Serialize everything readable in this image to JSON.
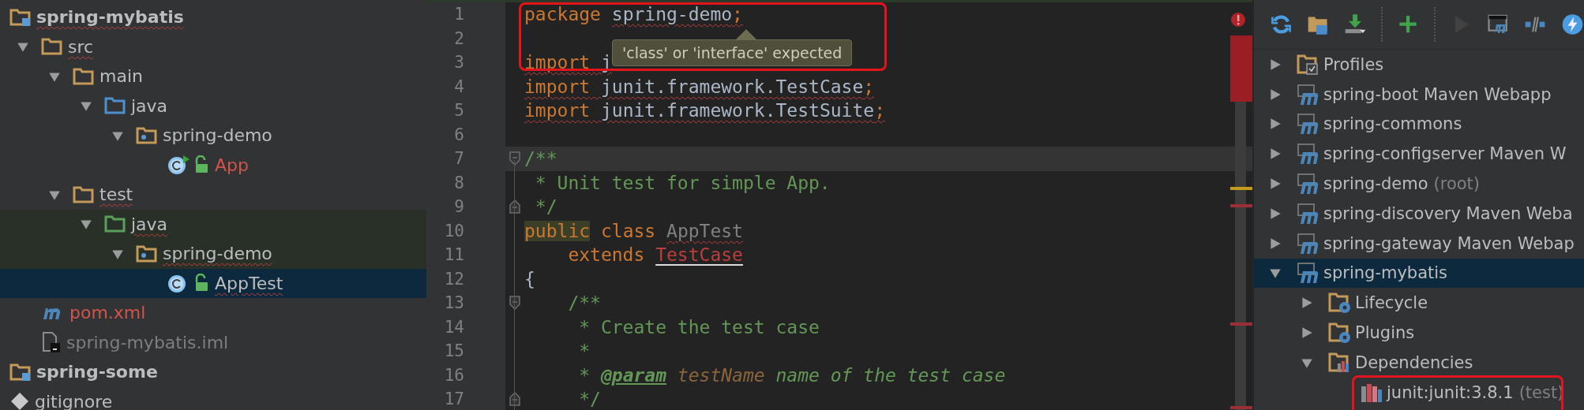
{
  "project_tree": [
    {
      "label": "spring-mybatis",
      "kind": "module",
      "selected": false,
      "tinted": false,
      "error": true,
      "unversioned": false,
      "ignored": false,
      "children": [
        {
          "label": "src",
          "kind": "folder",
          "expanded": true,
          "selected": false,
          "tinted": false,
          "error": true,
          "unversioned": false,
          "ignored": false,
          "children": [
            {
              "label": "main",
              "kind": "folder",
              "expanded": true,
              "selected": false,
              "tinted": false,
              "error": false,
              "unversioned": false,
              "ignored": false,
              "children": [
                {
                  "label": "java",
                  "kind": "source-folder",
                  "expanded": true,
                  "selected": false,
                  "tinted": false,
                  "error": false,
                  "unversioned": false,
                  "ignored": false,
                  "children": [
                    {
                      "label": "spring-demo",
                      "kind": "package",
                      "expanded": true,
                      "selected": false,
                      "tinted": false,
                      "error": false,
                      "unversioned": false,
                      "ignored": false,
                      "children": [
                        {
                          "label": "App",
                          "kind": "class-runnable",
                          "selected": false,
                          "tinted": false,
                          "error": false,
                          "unversioned": true,
                          "ignored": false
                        }
                      ]
                    }
                  ]
                }
              ]
            },
            {
              "label": "test",
              "kind": "folder",
              "expanded": true,
              "selected": false,
              "tinted": false,
              "error": true,
              "unversioned": false,
              "ignored": false,
              "children": [
                {
                  "label": "java",
                  "kind": "test-folder",
                  "expanded": true,
                  "selected": false,
                  "tinted": true,
                  "error": true,
                  "unversioned": false,
                  "ignored": false,
                  "children": [
                    {
                      "label": "spring-demo",
                      "kind": "package",
                      "expanded": true,
                      "selected": false,
                      "tinted": true,
                      "error": true,
                      "unversioned": false,
                      "ignored": false,
                      "children": [
                        {
                          "label": "AppTest",
                          "kind": "class",
                          "selected": true,
                          "tinted": false,
                          "error": true,
                          "unversioned": false,
                          "ignored": false
                        }
                      ]
                    }
                  ]
                }
              ]
            }
          ]
        },
        {
          "label": "pom.xml",
          "kind": "maven-file",
          "selected": false,
          "tinted": false,
          "error": false,
          "unversioned": true,
          "ignored": false
        },
        {
          "label": "spring-mybatis.iml",
          "kind": "iml-file",
          "selected": false,
          "tinted": false,
          "error": false,
          "unversioned": false,
          "ignored": true
        }
      ]
    },
    {
      "label": "spring-some",
      "kind": "module",
      "selected": false,
      "tinted": false,
      "error": false,
      "unversioned": false,
      "ignored": false
    },
    {
      "label": "gitignore",
      "kind": "git-file",
      "selected": false,
      "tinted": false,
      "unversioned": false,
      "ignored": false
    }
  ],
  "editor": {
    "tooltip": "'class' or 'interface' expected",
    "lines": [
      {
        "number": "1",
        "current": false,
        "kind": "plain",
        "tokens": [
          {
            "text": "package ",
            "kind": "keyword",
            "error": false
          },
          {
            "text": "spring-demo",
            "kind": "ident",
            "error": true
          },
          {
            "text": ";",
            "kind": "punct",
            "error": true
          }
        ]
      },
      {
        "number": "2",
        "current": false,
        "kind": "plain"
      },
      {
        "number": "3",
        "current": false,
        "kind": "plain",
        "tokens": [
          {
            "text": "import",
            "kind": "keyword",
            "error": true
          },
          {
            "text": " j",
            "kind": "ident",
            "error": true
          }
        ]
      },
      {
        "number": "4",
        "current": false,
        "kind": "plain",
        "tokens": [
          {
            "text": "import",
            "kind": "keyword",
            "error": true
          },
          {
            "text": " junit.framework.TestCase",
            "kind": "ident",
            "error": true
          },
          {
            "text": ";",
            "kind": "punct",
            "error": true
          }
        ]
      },
      {
        "number": "5",
        "current": false,
        "kind": "plain",
        "tokens": [
          {
            "text": "import",
            "kind": "keyword",
            "error": true
          },
          {
            "text": " junit.framework.TestSuite",
            "kind": "ident",
            "error": true
          },
          {
            "text": ";",
            "kind": "punct",
            "error": true
          }
        ]
      },
      {
        "number": "6",
        "current": false,
        "kind": "plain"
      },
      {
        "number": "7",
        "current": true,
        "kind": "fold-start",
        "tokens": [
          {
            "text": "/**",
            "kind": "comment",
            "error": false
          }
        ]
      },
      {
        "number": "8",
        "current": false,
        "kind": "plain",
        "tokens": [
          {
            "text": " * Unit test for simple App.",
            "kind": "comment",
            "error": false
          }
        ]
      },
      {
        "number": "9",
        "current": false,
        "kind": "fold-end",
        "tokens": [
          {
            "text": " */",
            "kind": "comment",
            "error": false
          }
        ]
      },
      {
        "number": "10",
        "current": false,
        "kind": "plain",
        "tokens": [
          {
            "text": "public",
            "kind": "keyword-marked",
            "error": false
          },
          {
            "text": " class ",
            "kind": "keyword",
            "error": false
          },
          {
            "text": "AppTest",
            "kind": "unused",
            "error": true
          }
        ]
      },
      {
        "number": "11",
        "current": false,
        "kind": "plain",
        "tokens": [
          {
            "text": "    extends ",
            "kind": "keyword",
            "error": false
          },
          {
            "text": "TestCase",
            "kind": "unresolved",
            "error": false
          }
        ]
      },
      {
        "number": "12",
        "current": false,
        "kind": "plain",
        "tokens": [
          {
            "text": "{",
            "kind": "ident",
            "error": false
          }
        ]
      },
      {
        "number": "13",
        "current": false,
        "kind": "fold-start",
        "tokens": [
          {
            "text": "    /**",
            "kind": "comment",
            "error": false
          }
        ]
      },
      {
        "number": "14",
        "current": false,
        "kind": "plain",
        "tokens": [
          {
            "text": "     * Create the test case",
            "kind": "comment",
            "error": false
          }
        ]
      },
      {
        "number": "15",
        "current": false,
        "kind": "plain",
        "tokens": [
          {
            "text": "     *",
            "kind": "comment",
            "error": false
          }
        ]
      },
      {
        "number": "16",
        "current": false,
        "kind": "plain",
        "tokens": [
          {
            "text": "     * ",
            "kind": "comment",
            "error": false
          },
          {
            "text": "@param",
            "kind": "doc-tag",
            "error": false
          },
          {
            "text": " testName",
            "kind": "doc-param",
            "error": false
          },
          {
            "text": " name of the test case",
            "kind": "comment",
            "error": false
          }
        ]
      },
      {
        "number": "17",
        "current": false,
        "kind": "fold-end",
        "tokens": [
          {
            "text": "     */",
            "kind": "comment",
            "error": false
          }
        ]
      }
    ]
  },
  "maven_panel": {
    "toolbar": [
      {
        "kind": "refresh",
        "disabled": false
      },
      {
        "kind": "folder-sync",
        "disabled": false
      },
      {
        "kind": "download",
        "disabled": false
      },
      {
        "kind": "separator"
      },
      {
        "kind": "add",
        "disabled": false
      },
      {
        "kind": "separator"
      },
      {
        "kind": "run",
        "disabled": true
      },
      {
        "kind": "maven-window",
        "disabled": false
      },
      {
        "kind": "toggle",
        "disabled": false
      },
      {
        "kind": "lightning",
        "disabled": false
      }
    ],
    "tree": [
      {
        "label": "Profiles",
        "kind": "profiles",
        "expanded": false,
        "selected": false
      },
      {
        "label": "spring-boot Maven Webapp",
        "kind": "maven-project",
        "expanded": false,
        "selected": false
      },
      {
        "label": "spring-commons",
        "kind": "maven-project",
        "expanded": false,
        "selected": false
      },
      {
        "label": "spring-configserver Maven W",
        "kind": "maven-project",
        "expanded": false,
        "selected": false
      },
      {
        "label": "spring-demo",
        "suffix": "(root)",
        "kind": "maven-project",
        "expanded": false,
        "selected": false
      },
      {
        "label": "spring-discovery Maven Weba",
        "kind": "maven-project",
        "expanded": false,
        "selected": false
      },
      {
        "label": "spring-gateway Maven Webap",
        "kind": "maven-project",
        "expanded": false,
        "selected": false
      },
      {
        "label": "spring-mybatis",
        "kind": "maven-project",
        "expanded": true,
        "selected": true,
        "children": [
          {
            "label": "Lifecycle",
            "kind": "gear-folder",
            "expanded": false,
            "selected": false
          },
          {
            "label": "Plugins",
            "kind": "gear-folder",
            "expanded": false,
            "selected": false
          },
          {
            "label": "Dependencies",
            "kind": "dependencies",
            "expanded": true,
            "selected": false,
            "children": [
              {
                "label": "junit:junit:3.8.1",
                "suffix": "(test)",
                "kind": "library",
                "selected": false
              }
            ]
          }
        ]
      }
    ]
  }
}
